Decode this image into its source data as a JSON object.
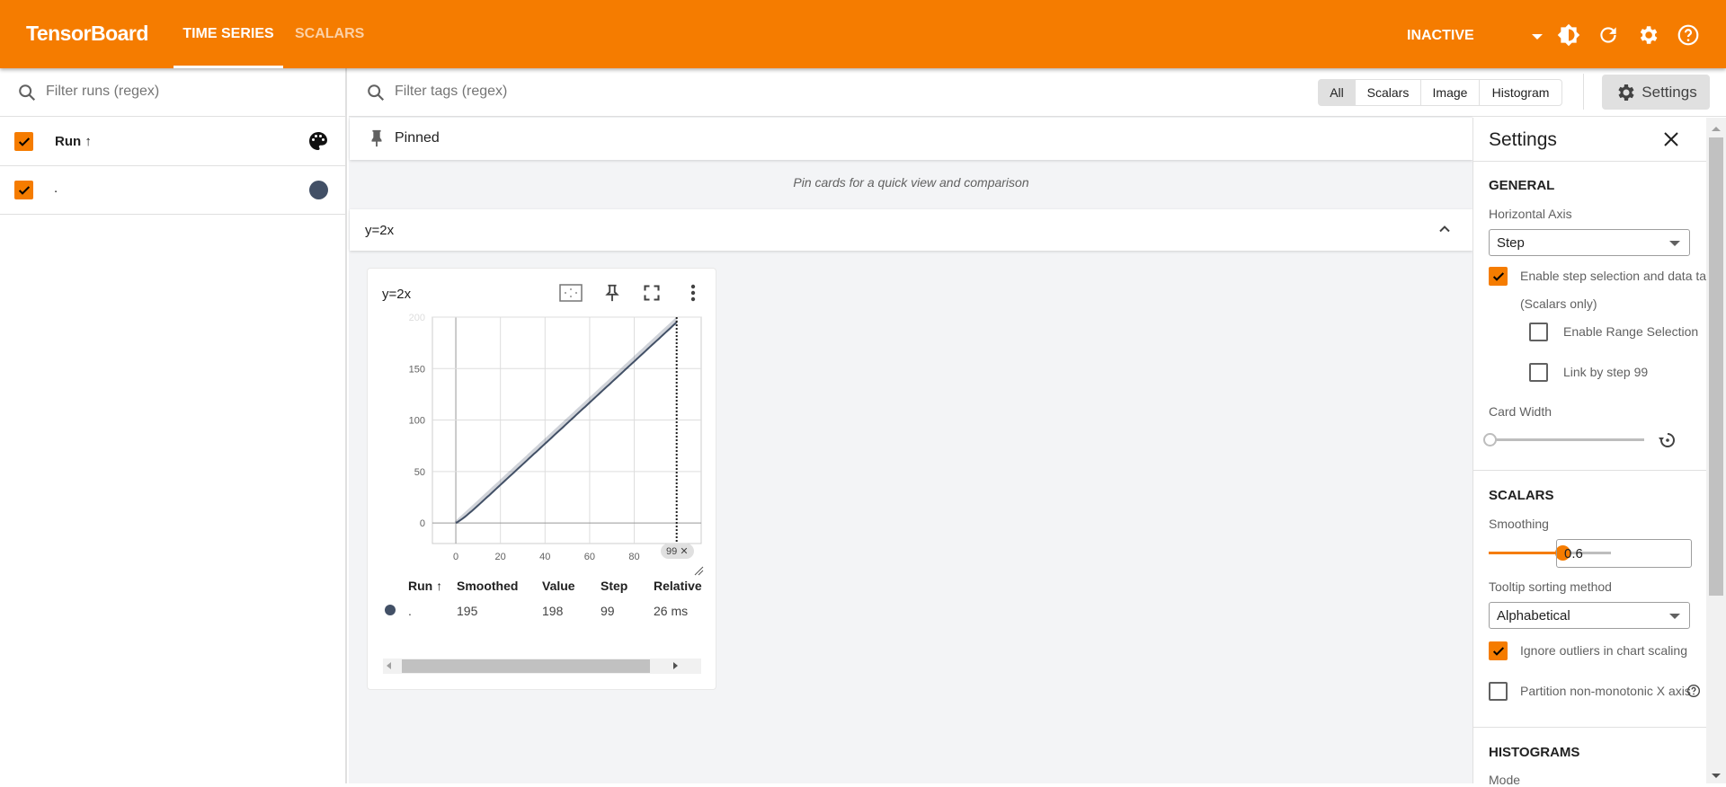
{
  "header": {
    "logo": "TensorBoard",
    "tabs": [
      {
        "label": "TIME SERIES",
        "active": true
      },
      {
        "label": "SCALARS",
        "active": false
      }
    ],
    "status": "INACTIVE",
    "icons": [
      "theme-icon",
      "reload-icon",
      "settings-icon",
      "help-icon"
    ],
    "accent": "#f57c00"
  },
  "runs": {
    "filter_placeholder": "Filter runs (regex)",
    "header": "Run ↑",
    "items": [
      {
        "name": ".",
        "checked": true,
        "color": "#425066"
      }
    ]
  },
  "toolbar": {
    "filter_placeholder": "Filter tags (regex)",
    "type_buttons": [
      "All",
      "Scalars",
      "Image",
      "Histogram"
    ],
    "selected_type": "All",
    "settings_label": "Settings"
  },
  "pinned": {
    "title": "Pinned",
    "empty_message": "Pin cards for a quick view and comparison"
  },
  "group": {
    "title": "y=2x"
  },
  "card": {
    "title": "y=2x",
    "step_chip": "99",
    "table": {
      "headers": [
        "Run ↑",
        "Smoothed",
        "Value",
        "Step",
        "Relative"
      ],
      "rows": [
        {
          "run": ".",
          "smoothed": "195",
          "value": "198",
          "step": "99",
          "relative": "26 ms",
          "color": "#425066"
        }
      ]
    }
  },
  "chart_data": {
    "type": "line",
    "title": "y=2x",
    "xlim": [
      -10.5,
      110
    ],
    "ylim": [
      -20,
      200
    ],
    "xticks": [
      0,
      20,
      40,
      60,
      80
    ],
    "yticks": [
      0,
      50,
      100,
      150,
      200
    ],
    "grid": true,
    "selected_step": 99,
    "smoothing": 0.6,
    "series": [
      {
        "color": "#425066",
        "x": [
          0,
          1,
          2,
          3,
          4,
          5,
          6,
          7,
          8,
          9,
          10,
          11,
          12,
          13,
          14,
          15,
          16,
          17,
          18,
          19,
          20,
          21,
          22,
          23,
          24,
          25,
          26,
          27,
          28,
          29,
          30,
          31,
          32,
          33,
          34,
          35,
          36,
          37,
          38,
          39,
          40,
          41,
          42,
          43,
          44,
          45,
          46,
          47,
          48,
          49,
          50,
          51,
          52,
          53,
          54,
          55,
          56,
          57,
          58,
          59,
          60,
          61,
          62,
          63,
          64,
          65,
          66,
          67,
          68,
          69,
          70,
          71,
          72,
          73,
          74,
          75,
          76,
          77,
          78,
          79,
          80,
          81,
          82,
          83,
          84,
          85,
          86,
          87,
          88,
          89,
          90,
          91,
          92,
          93,
          94,
          95,
          96,
          97,
          98,
          99
        ],
        "y": [
          0,
          2,
          4,
          6,
          8,
          10,
          12,
          14,
          16,
          18,
          20,
          22,
          24,
          26,
          28,
          30,
          32,
          34,
          36,
          38,
          40,
          42,
          44,
          46,
          48,
          50,
          52,
          54,
          56,
          58,
          60,
          62,
          64,
          66,
          68,
          70,
          72,
          74,
          76,
          78,
          80,
          82,
          84,
          86,
          88,
          90,
          92,
          94,
          96,
          98,
          100,
          102,
          104,
          106,
          108,
          110,
          112,
          114,
          116,
          118,
          120,
          122,
          124,
          126,
          128,
          130,
          132,
          134,
          136,
          138,
          140,
          142,
          144,
          146,
          148,
          150,
          152,
          154,
          156,
          158,
          160,
          162,
          164,
          166,
          168,
          170,
          172,
          174,
          176,
          178,
          180,
          182,
          184,
          186,
          188,
          190,
          192,
          194,
          196,
          198
        ]
      }
    ]
  },
  "settings": {
    "title": "Settings",
    "general": {
      "title": "GENERAL",
      "horizontal_axis_label": "Horizontal Axis",
      "horizontal_axis_value": "Step",
      "step_selection_label": "Enable step selection and data tabl",
      "step_selection_checked": true,
      "scalars_only": "(Scalars only)",
      "range_selection_label": "Enable Range Selection",
      "range_selection_checked": false,
      "link_by_step_label": "Link by step 99",
      "link_by_step_checked": false,
      "card_width_label": "Card Width",
      "card_width_value": 0
    },
    "scalars": {
      "title": "SCALARS",
      "smoothing_label": "Smoothing",
      "smoothing_value": "0.6",
      "smoothing_fraction": 0.6,
      "tooltip_sort_label": "Tooltip sorting method",
      "tooltip_sort_value": "Alphabetical",
      "ignore_outliers_label": "Ignore outliers in chart scaling",
      "ignore_outliers_checked": true,
      "partition_label": "Partition non-monotonic X axis",
      "partition_checked": false
    },
    "histograms": {
      "title": "HISTOGRAMS",
      "mode_label": "Mode"
    }
  }
}
